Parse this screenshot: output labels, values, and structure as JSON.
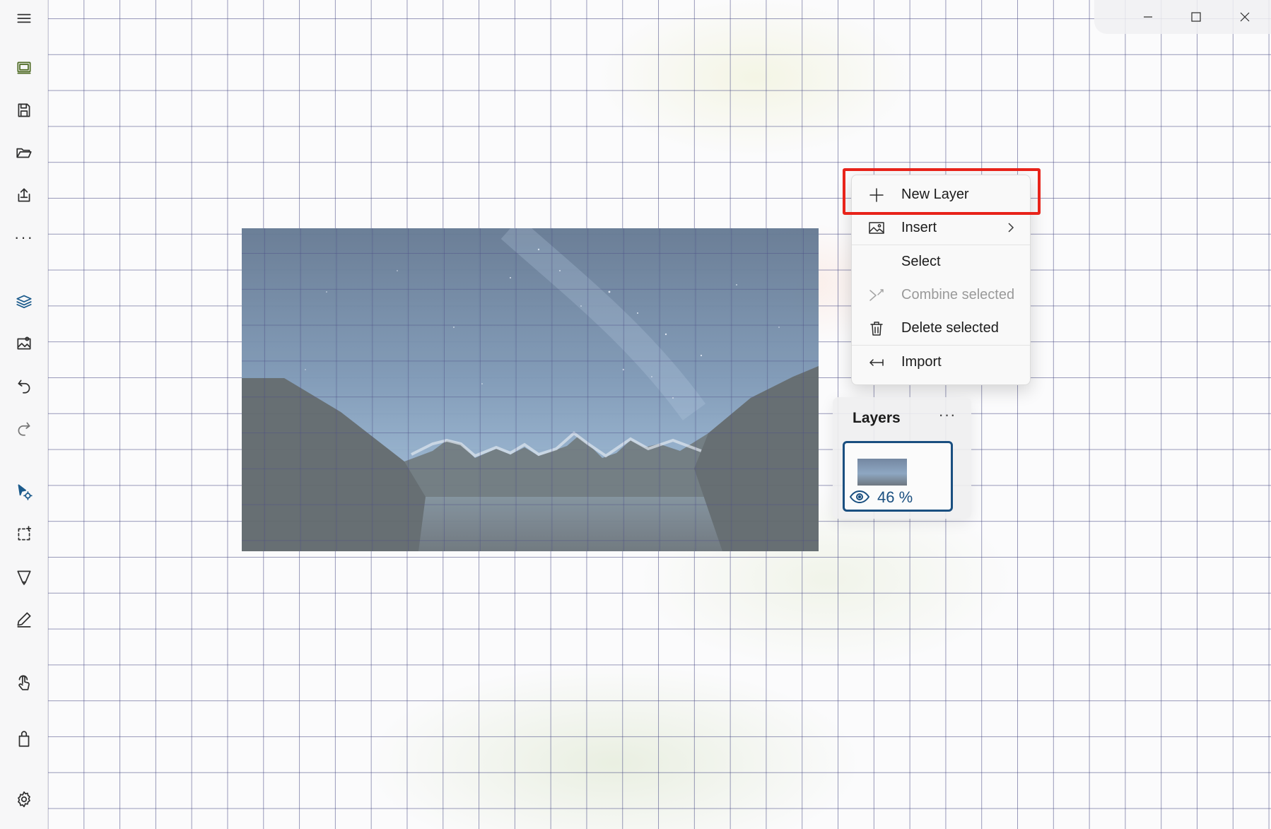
{
  "sidebar": {
    "items": [
      {
        "icon": "hamburger-menu-icon"
      },
      {
        "icon": "canvas-frame-icon"
      },
      {
        "icon": "save-icon"
      },
      {
        "icon": "open-folder-icon"
      },
      {
        "icon": "share-export-icon"
      },
      {
        "icon": "more-dots-icon",
        "glyph": "···"
      },
      {
        "icon": "layers-icon"
      },
      {
        "icon": "insert-image-icon"
      },
      {
        "icon": "undo-icon"
      },
      {
        "icon": "redo-icon"
      },
      {
        "icon": "select-pointer-icon"
      },
      {
        "icon": "rectangle-select-icon"
      },
      {
        "icon": "lasso-icon"
      },
      {
        "icon": "pencil-icon"
      },
      {
        "icon": "touch-hand-icon"
      },
      {
        "icon": "store-bag-icon"
      },
      {
        "icon": "settings-gear-icon"
      }
    ]
  },
  "window_controls": {
    "minimize": "minimize-icon",
    "maximize": "maximize-icon",
    "close": "close-icon"
  },
  "context_menu": {
    "items": [
      {
        "label": "New Layer",
        "icon": "plus-icon",
        "enabled": true,
        "highlighted": true
      },
      {
        "label": "Insert",
        "icon": "image-icon",
        "enabled": true,
        "submenu": true
      },
      {
        "label": "Select",
        "icon": "",
        "enabled": true
      },
      {
        "label": "Combine selected",
        "icon": "combine-icon",
        "enabled": false
      },
      {
        "label": "Delete selected",
        "icon": "trash-icon",
        "enabled": true
      },
      {
        "label": "Import",
        "icon": "import-arrow-icon",
        "enabled": true
      }
    ]
  },
  "layers_panel": {
    "title": "Layers",
    "more_glyph": "···",
    "layer": {
      "opacity_label": "46 %",
      "visible": true
    }
  },
  "colors": {
    "accent": "#1a4f80",
    "highlight_box": "#e8231a",
    "grid_line": "#46488a"
  }
}
